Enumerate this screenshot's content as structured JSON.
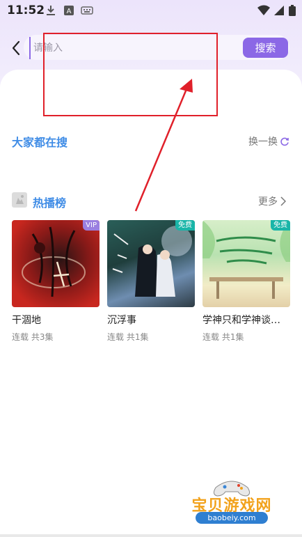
{
  "status_bar": {
    "time": "11:52",
    "icons": [
      "download-icon",
      "text-a-icon",
      "keyboard-icon",
      "wifi-icon",
      "signal-icon",
      "battery-icon"
    ]
  },
  "header": {
    "back_icon": "chevron-left-icon",
    "search_placeholder": "请输入",
    "search_value": "",
    "search_button": "搜索"
  },
  "hot_search": {
    "title": "大家都在搜",
    "refresh_label": "换一换",
    "refresh_icon": "refresh-icon"
  },
  "hot_list": {
    "title": "热播榜",
    "more_label": "更多",
    "more_icon": "chevron-right-icon",
    "items": [
      {
        "title": "干涸地",
        "subtitle": "连载 共3集",
        "badge": "VIP"
      },
      {
        "title": "沉浮事",
        "subtitle": "连载 共1集",
        "badge": "免费"
      },
      {
        "title": "学神只和学神谈…",
        "subtitle": "连载 共1集",
        "badge": "免费"
      }
    ]
  },
  "watermark": {
    "text": "宝贝游戏网",
    "url": "baobeiy.com"
  },
  "colors": {
    "accent": "#8b68e6",
    "section_blue": "#3f8ce6",
    "annotation_red": "#e0202a",
    "free_badge": "#19b5a8",
    "vip_badge": "#9a7fe0"
  }
}
